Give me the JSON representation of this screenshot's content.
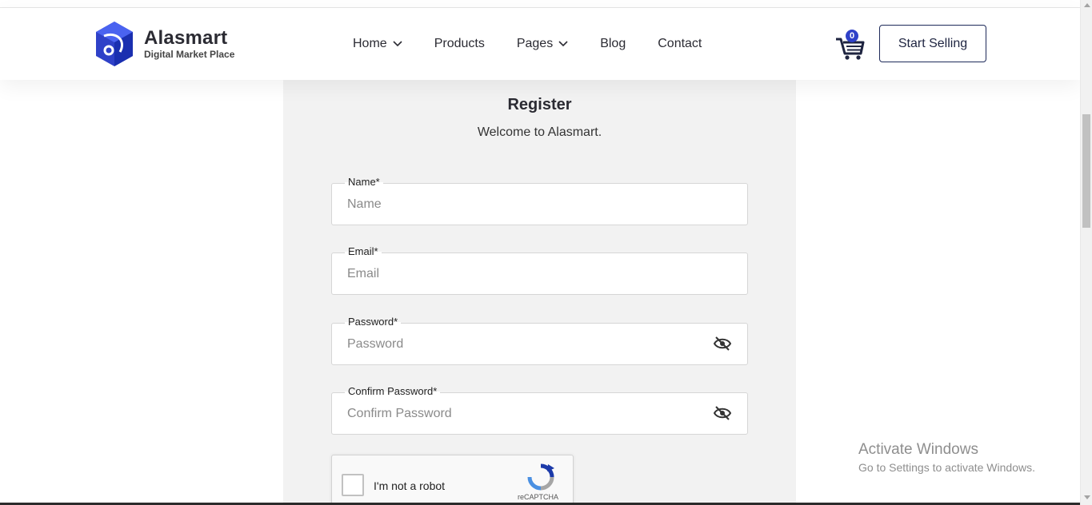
{
  "header": {
    "logo_title": "Alasmart",
    "logo_subtitle": "Digital Market Place",
    "nav": [
      {
        "label": "Home",
        "dropdown": true
      },
      {
        "label": "Products",
        "dropdown": false
      },
      {
        "label": "Pages",
        "dropdown": true
      },
      {
        "label": "Blog",
        "dropdown": false
      },
      {
        "label": "Contact",
        "dropdown": false
      }
    ],
    "cart_count": "0",
    "start_selling_label": "Start Selling"
  },
  "form": {
    "title": "Register",
    "welcome": "Welcome to Alasmart.",
    "fields": {
      "name": {
        "label": "Name*",
        "placeholder": "Name",
        "value": ""
      },
      "email": {
        "label": "Email*",
        "placeholder": "Email",
        "value": ""
      },
      "password": {
        "label": "Password*",
        "placeholder": "Password",
        "value": ""
      },
      "confirm": {
        "label": "Confirm Password*",
        "placeholder": "Confirm Password",
        "value": ""
      }
    },
    "captcha": {
      "label": "I'm not a robot",
      "brand": "reCAPTCHA"
    }
  },
  "watermark": {
    "title": "Activate Windows",
    "subtitle": "Go to Settings to activate Windows."
  },
  "colors": {
    "brand_blue": "#2f41c8",
    "card_bg": "#f2f2f2",
    "button_border": "#1e2a5a"
  }
}
